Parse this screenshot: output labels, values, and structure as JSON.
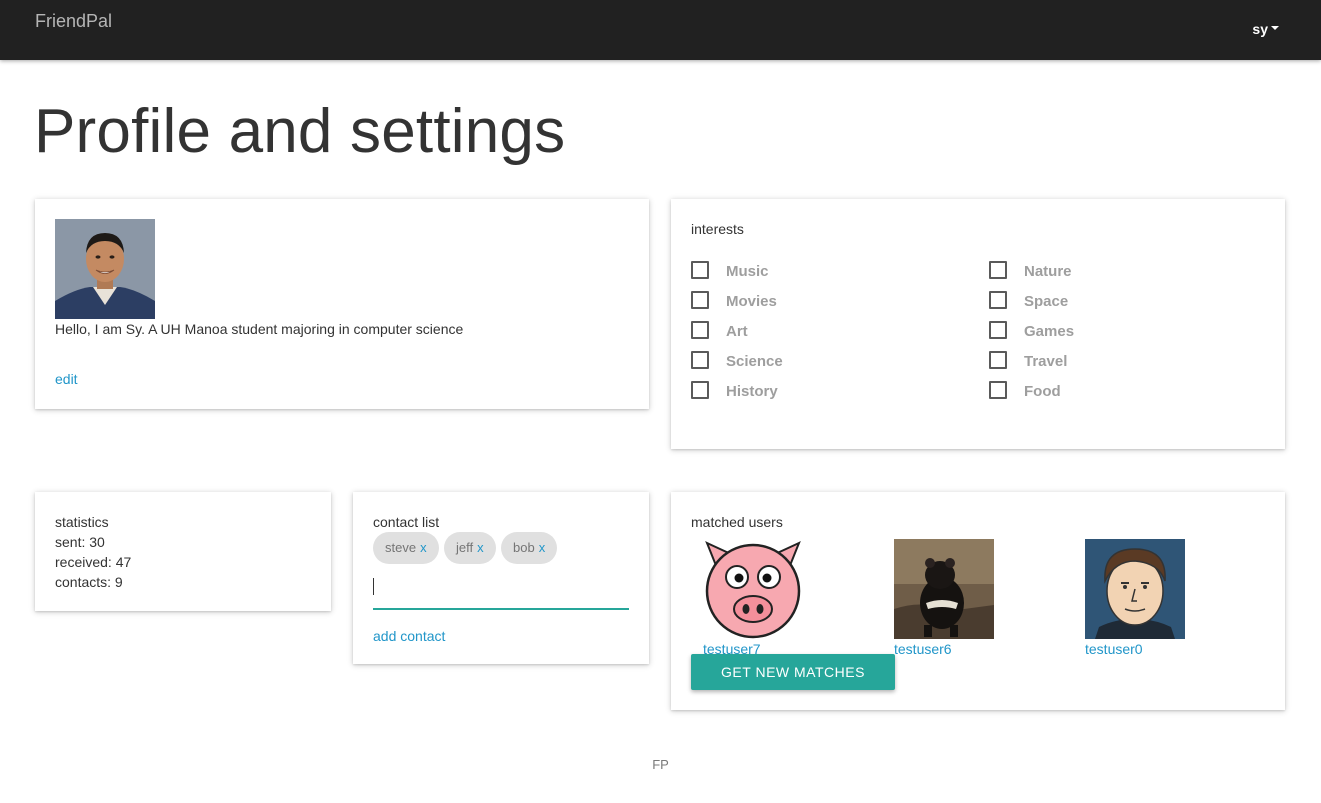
{
  "navbar": {
    "brand": "FriendPal",
    "user": "sy"
  },
  "page": {
    "title": "Profile and settings"
  },
  "profile": {
    "bio": "Hello, I am Sy. A UH Manoa student majoring in computer science",
    "edit_label": "edit"
  },
  "interests": {
    "label": "interests",
    "left": [
      "Music",
      "Movies",
      "Art",
      "Science",
      "History"
    ],
    "right": [
      "Nature",
      "Space",
      "Games",
      "Travel",
      "Food"
    ]
  },
  "statistics": {
    "label": "statistics",
    "sent": "sent: 30",
    "received": "received: 47",
    "contacts": "contacts: 9"
  },
  "contacts": {
    "label": "contact list",
    "chips": [
      "steve",
      "jeff",
      "bob"
    ],
    "remove_symbol": "x",
    "input_value": "",
    "add_label": "add contact"
  },
  "matched": {
    "label": "matched users",
    "users": [
      "testuser7",
      "testuser6",
      "testuser0"
    ],
    "button_label": "GET NEW MATCHES"
  },
  "footer": {
    "text": "FP"
  },
  "colors": {
    "navbar": "#212121",
    "accent": "#26a69a",
    "link": "#2196c9"
  }
}
